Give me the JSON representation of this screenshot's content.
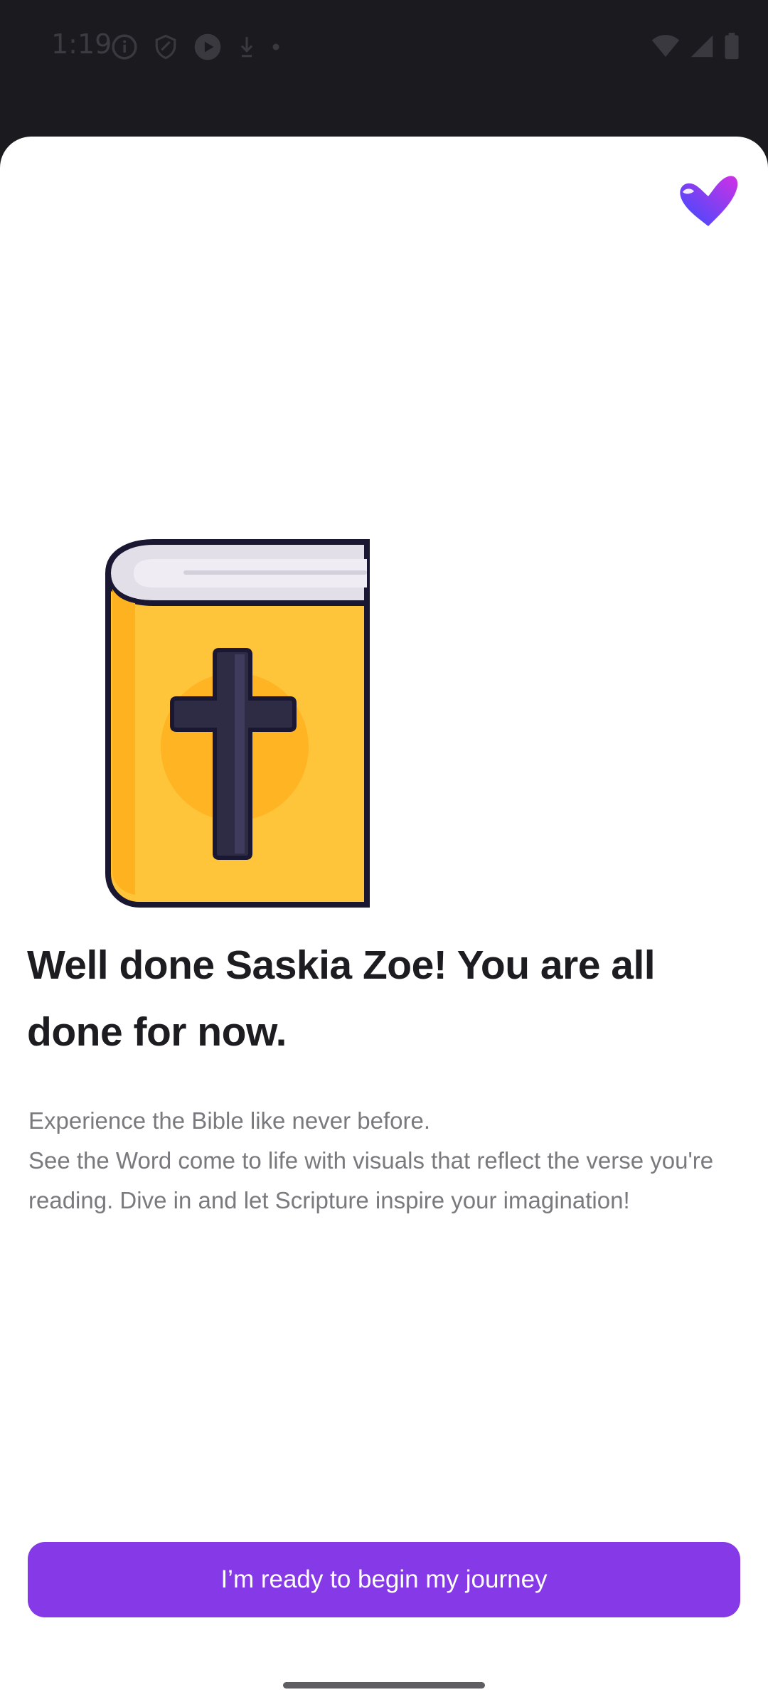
{
  "status_bar": {
    "time": "1:19",
    "left_icons": [
      "info-icon",
      "shield-icon",
      "play-icon",
      "download-icon",
      "dot-icon"
    ],
    "right_icons": [
      "wifi-icon",
      "signal-icon",
      "battery-icon"
    ]
  },
  "sheet": {
    "logo_icon": "heart-logo-icon",
    "illustration_icon": "bible-icon",
    "title": "Well done Saskia Zoe! You are all done for now.",
    "body_line1": "Experience the Bible like never before.",
    "body_line2": "See the Word come to life with visuals that reflect the verse you're reading. Dive in and let Scripture inspire your imagination!",
    "cta_label": "I’m ready to begin my journey"
  },
  "colors": {
    "accent": "#8639e6",
    "title_text": "#1d1c20",
    "body_text": "#7a797e",
    "book_cover": "#ffc53a",
    "book_outline": "#1a1733"
  }
}
